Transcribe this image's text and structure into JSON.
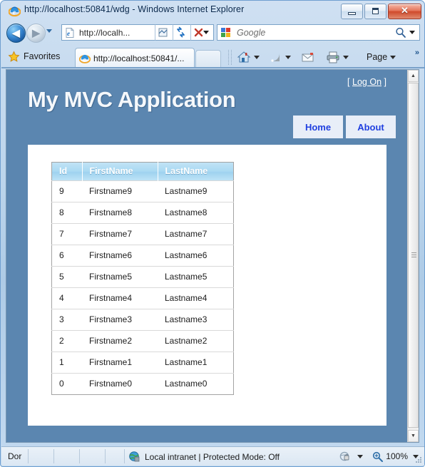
{
  "window": {
    "title": "http://localhost:50841/wdg - Windows Internet Explorer",
    "icon": "ie-logo-icon",
    "minimize_label": "—",
    "maximize_label": "□",
    "close_label": "✕"
  },
  "toolbar": {
    "back_label": "◀",
    "forward_label": "▶",
    "history_label": "recent-pages",
    "address_value": "http://localh...",
    "address_icon": "page-icon",
    "compatibility_label": "compatibility-view",
    "refresh_label": "↺",
    "stop_label": "✕",
    "search_placeholder": "Google",
    "search_provider": "google-logo-icon",
    "search_button_label": "search-icon"
  },
  "favbar": {
    "favorites_label": "Favorites",
    "favorites_icon": "star-icon",
    "tab_title": "http://localhost:50841/...",
    "tab_icon": "ie-logo-icon",
    "new_tab_label": "new-tab",
    "commands": [
      {
        "name": "home",
        "icon": "home-icon",
        "label": "",
        "has_caret": true
      },
      {
        "name": "feeds",
        "icon": "rss-icon",
        "label": "",
        "has_caret": true
      },
      {
        "name": "mail",
        "icon": "mail-icon",
        "label": "",
        "has_caret": false
      },
      {
        "name": "print",
        "icon": "printer-icon",
        "label": "",
        "has_caret": true
      },
      {
        "name": "page",
        "icon": "",
        "label": "Page",
        "has_caret": true
      }
    ],
    "overflow_label": "»"
  },
  "page": {
    "logon_open_bracket": "[",
    "logon_label": "Log On",
    "logon_close_bracket": "]",
    "site_title": "My MVC Application",
    "menu": [
      {
        "label": "Home"
      },
      {
        "label": "About"
      }
    ],
    "table": {
      "columns": [
        "Id",
        "FirstName",
        "LastName"
      ],
      "rows": [
        {
          "id": "9",
          "first": "Firstname9",
          "last": "Lastname9"
        },
        {
          "id": "8",
          "first": "Firstname8",
          "last": "Lastname8"
        },
        {
          "id": "7",
          "first": "Firstname7",
          "last": "Lastname7"
        },
        {
          "id": "6",
          "first": "Firstname6",
          "last": "Lastname6"
        },
        {
          "id": "5",
          "first": "Firstname5",
          "last": "Lastname5"
        },
        {
          "id": "4",
          "first": "Firstname4",
          "last": "Lastname4"
        },
        {
          "id": "3",
          "first": "Firstname3",
          "last": "Lastname3"
        },
        {
          "id": "2",
          "first": "Firstname2",
          "last": "Lastname2"
        },
        {
          "id": "1",
          "first": "Firstname1",
          "last": "Lastname1"
        },
        {
          "id": "0",
          "first": "Firstname0",
          "last": "Lastname0"
        }
      ]
    },
    "scrollbar": {
      "up_label": "▲",
      "down_label": "▼"
    }
  },
  "statusbar": {
    "progress_text": "Dor",
    "zone_icon": "globe-icon",
    "zone_text": "Local intranet | Protected Mode: Off",
    "privacy_icon": "privacy-report-icon",
    "zoom_icon": "zoom-icon",
    "zoom_level": "100%"
  },
  "colors": {
    "page_header_blue": "#5b86b0",
    "menu_link_blue": "#2040e0",
    "table_header_blue": "#a9d9f2",
    "close_button_red": "#cf4a2c"
  }
}
